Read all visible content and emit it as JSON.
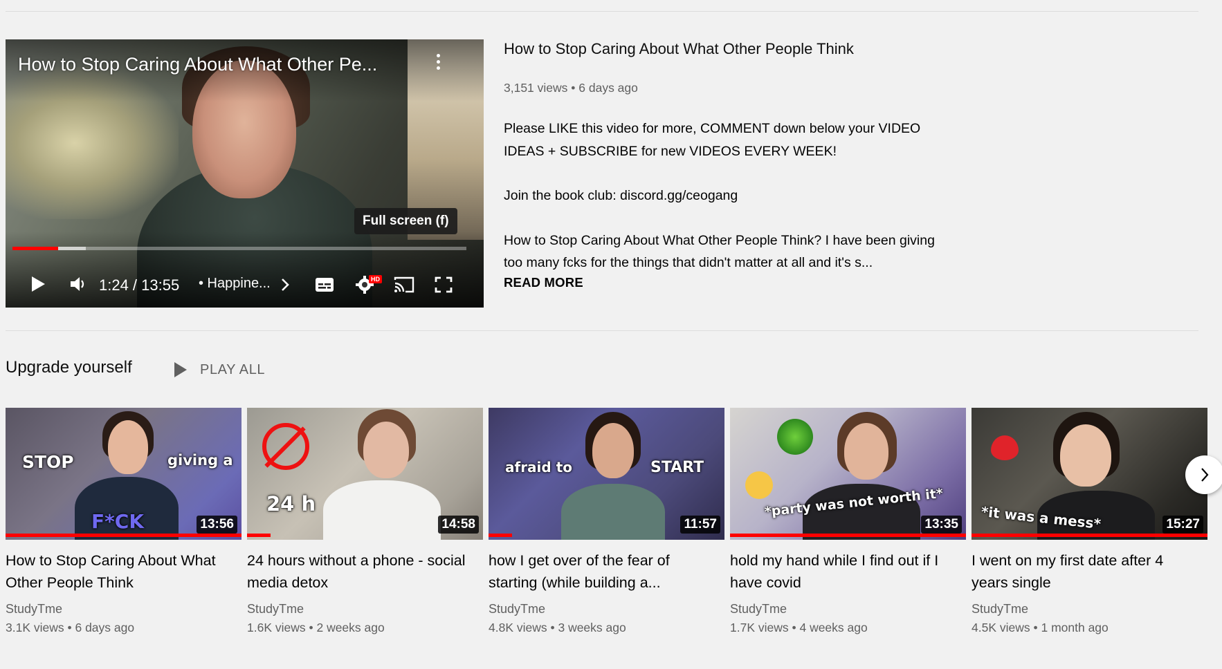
{
  "player": {
    "title": "How to Stop Caring About What Other Pe...",
    "tooltip": "Full screen (f)",
    "time": "1:24 / 13:55",
    "chapter": "• Happine...",
    "hd_badge": "HD",
    "progress_fraction": 0.1,
    "icons": [
      "play-icon",
      "volume-icon",
      "chevron-right-icon",
      "subtitles-icon",
      "settings-icon",
      "cast-icon",
      "fullscreen-icon",
      "more-vert-icon"
    ]
  },
  "featured": {
    "title": "How to Stop Caring About What Other People Think",
    "meta": "3,151 views • 6 days ago",
    "description": [
      "Please LIKE this video for more, COMMENT down below your VIDEO IDEAS + SUBSCRIBE for new VIDEOS EVERY WEEK!",
      "Join the book club: discord.gg/ceogang",
      "How to Stop Caring About What Other People Think? I have been giving too many fcks for the things that didn't matter at all and it's s..."
    ],
    "read_more": "READ MORE"
  },
  "shelf": {
    "title": "Upgrade yourself",
    "play_all": "PLAY ALL",
    "videos": [
      {
        "title": "How to Stop Caring About What Other People Think",
        "channel": "StudyTme",
        "meta": "3.1K views • 6 days ago",
        "duration": "13:56",
        "watched_fraction": 1.0,
        "overlay": [
          "STOP",
          "giving a",
          "F*CK"
        ]
      },
      {
        "title": "24 hours without a phone - social media detox",
        "channel": "StudyTme",
        "meta": "1.6K views • 2 weeks ago",
        "duration": "14:58",
        "watched_fraction": 0.1,
        "overlay": [
          "24 h"
        ]
      },
      {
        "title": "how I get over of the fear of starting (while building a...",
        "channel": "StudyTme",
        "meta": "4.8K views • 3 weeks ago",
        "duration": "11:57",
        "watched_fraction": 0.1,
        "overlay": [
          "afraid to",
          "START"
        ]
      },
      {
        "title": "hold my hand while I find out if I have covid",
        "channel": "StudyTme",
        "meta": "1.7K views • 4 weeks ago",
        "duration": "13:35",
        "watched_fraction": 1.0,
        "overlay": [
          "*party was not worth it*"
        ]
      },
      {
        "title": "I went on my first date after 4 years single",
        "channel": "StudyTme",
        "meta": "4.5K views • 1 month ago",
        "duration": "15:27",
        "watched_fraction": 1.0,
        "overlay": [
          "*it was a mess*"
        ]
      }
    ],
    "next_icon": "chevron-right-icon"
  },
  "colors": {
    "background": "#f1f1f1",
    "accent_red": "#ff0000",
    "secondary_text": "#606060"
  }
}
